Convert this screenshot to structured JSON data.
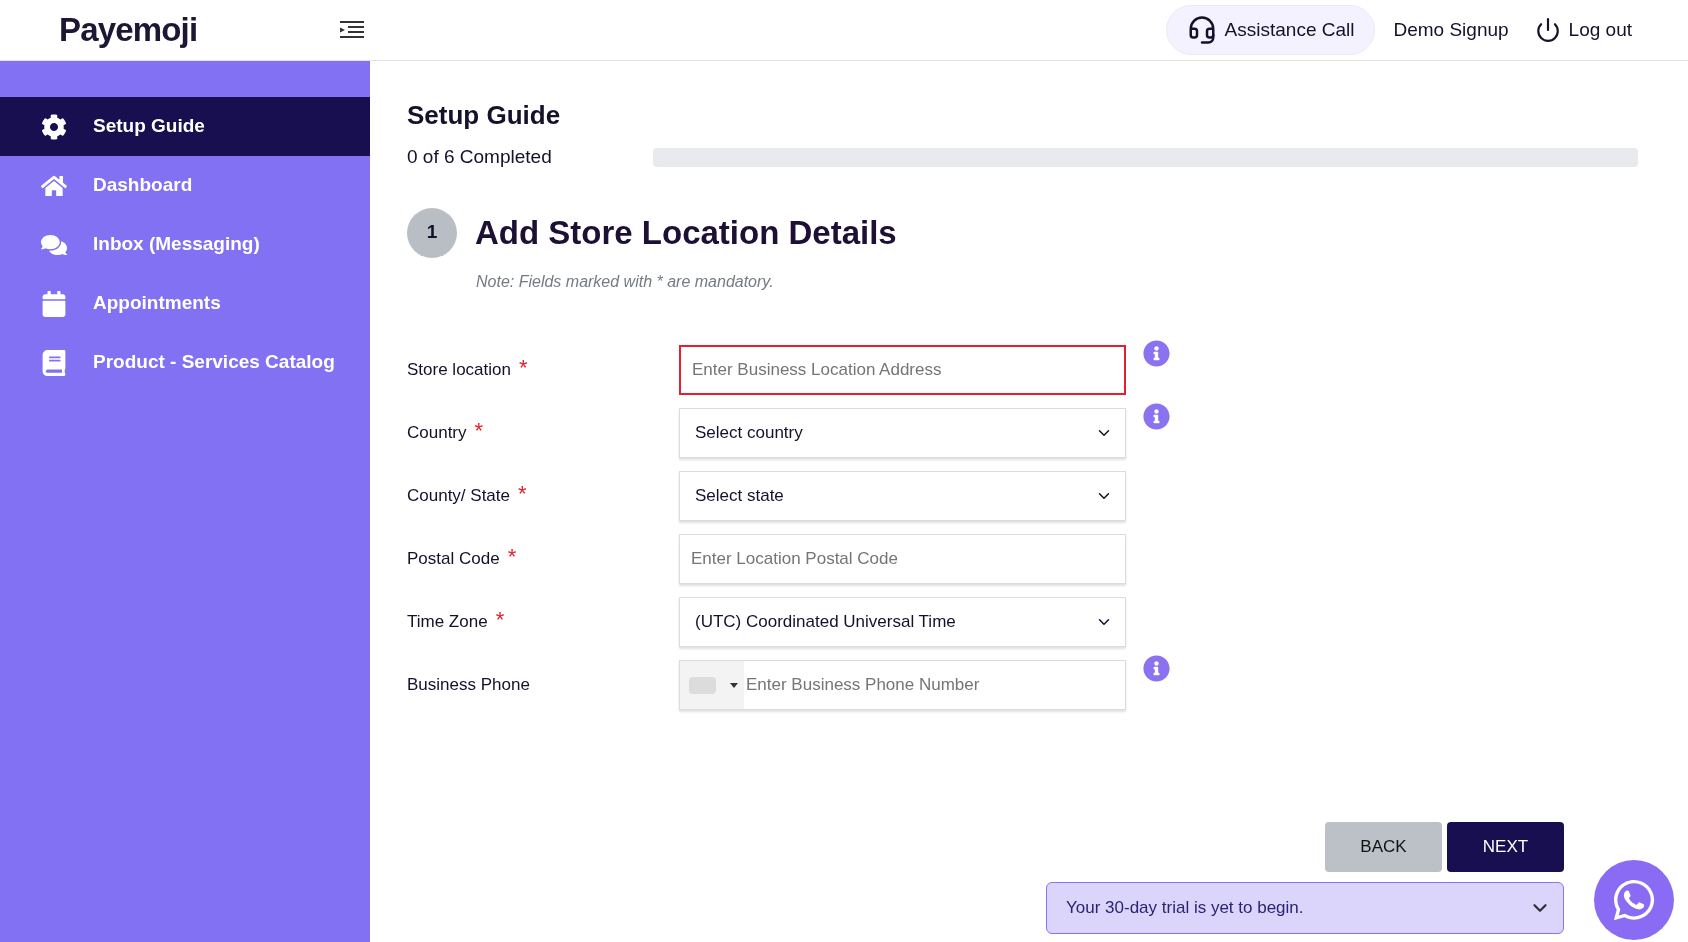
{
  "header": {
    "logo": "Payemoji",
    "actions": [
      {
        "kind": "pill",
        "label": "Assistance Call"
      },
      {
        "kind": "plain",
        "label": "Demo Signup"
      },
      {
        "kind": "power",
        "label": "Log out"
      }
    ]
  },
  "sidebar": {
    "items": [
      {
        "label": "Setup Guide",
        "selected": true
      },
      {
        "label": "Dashboard",
        "selected": false
      },
      {
        "label": "Inbox (Messaging)",
        "selected": false
      },
      {
        "label": "Appointments",
        "selected": false
      },
      {
        "label": "Product - Services Catalog",
        "selected": false
      }
    ]
  },
  "guide": {
    "title": "Setup Guide",
    "progress_text": "0 of 6 Completed",
    "level": 0
  },
  "step": {
    "number": "1",
    "title": "Add Store Location Details",
    "note": "Note: Fields marked with * are mandatory."
  },
  "fields": [
    {
      "kind": "text",
      "label": "Store location",
      "required_mark": "*",
      "placeholder": "Enter Business Location Address",
      "error": true,
      "info": true
    },
    {
      "kind": "select",
      "label": "Country",
      "required_mark": "*",
      "value": "Select country",
      "error": false,
      "info": true
    },
    {
      "kind": "select",
      "label": "County/ State",
      "required_mark": "*",
      "value": "Select state",
      "error": false,
      "info": false
    },
    {
      "kind": "text",
      "label": "Postal Code",
      "required_mark": "*",
      "placeholder": "Enter Location Postal Code",
      "error": false,
      "info": false
    },
    {
      "kind": "select",
      "label": "Time Zone",
      "required_mark": "*",
      "value": "(UTC) Coordinated Universal Time",
      "error": false,
      "info": false
    },
    {
      "kind": "phone",
      "label": "Business Phone",
      "placeholder": "Enter Business Phone Number",
      "error": false,
      "info": true
    }
  ],
  "buttons": [
    {
      "kind": "secondary",
      "label": "BACK"
    },
    {
      "kind": "primary",
      "label": "NEXT"
    }
  ],
  "trial_banner": {
    "text": "Your 30-day trial is yet to begin."
  }
}
